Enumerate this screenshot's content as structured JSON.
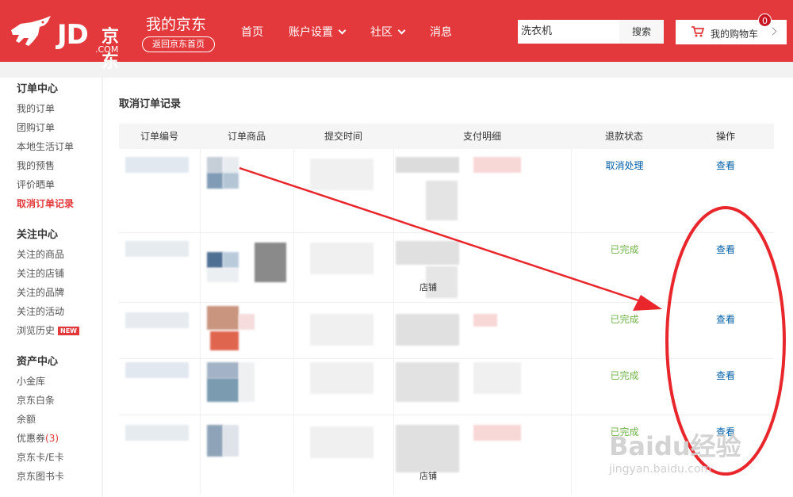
{
  "header": {
    "logo_text": "JD",
    "logo_cn": "京东",
    "logo_com": ".COM",
    "site_title": "我的京东",
    "home_return": "返回京东首页",
    "nav": [
      {
        "label": "首页",
        "has_dropdown": false
      },
      {
        "label": "账户设置",
        "has_dropdown": true
      },
      {
        "label": "社区",
        "has_dropdown": true
      },
      {
        "label": "消息",
        "has_dropdown": false
      }
    ],
    "search": {
      "value": "洗衣机",
      "button": "搜索"
    },
    "cart": {
      "label": "我的购物车",
      "count": "0",
      "icon": "cart-icon"
    },
    "brand_color": "#e4393c"
  },
  "sidebar": {
    "groups": [
      {
        "title": "订单中心",
        "items": [
          {
            "label": "我的订单"
          },
          {
            "label": "团购订单"
          },
          {
            "label": "本地生活订单"
          },
          {
            "label": "我的预售"
          },
          {
            "label": "评价晒单"
          },
          {
            "label": "取消订单记录",
            "active": true
          }
        ]
      },
      {
        "title": "关注中心",
        "items": [
          {
            "label": "关注的商品"
          },
          {
            "label": "关注的店铺"
          },
          {
            "label": "关注的品牌"
          },
          {
            "label": "关注的活动"
          },
          {
            "label": "浏览历史",
            "tag": "NEW"
          }
        ]
      },
      {
        "title": "资产中心",
        "items": [
          {
            "label": "小金库"
          },
          {
            "label": "京东白条"
          },
          {
            "label": "余额"
          },
          {
            "label": "优惠券",
            "count": "(3)"
          },
          {
            "label": "京东卡/E卡"
          },
          {
            "label": "京东图书卡"
          }
        ]
      }
    ]
  },
  "main": {
    "title": "取消订单记录",
    "columns": [
      "订单编号",
      "订单商品",
      "提交时间",
      "支付明细",
      "退款状态",
      "操作"
    ],
    "rows": [
      {
        "status": "取消处理",
        "status_type": "cancel",
        "action": "查看",
        "note": ""
      },
      {
        "status": "已完成",
        "status_type": "done",
        "action": "查看",
        "note": "店铺"
      },
      {
        "status": "已完成",
        "status_type": "done",
        "action": "查看",
        "note": ""
      },
      {
        "status": "已完成",
        "status_type": "done",
        "action": "查看",
        "note": ""
      },
      {
        "status": "已完成",
        "status_type": "done",
        "action": "查看",
        "note": "店铺"
      }
    ]
  },
  "watermark": {
    "text": "Baidu经验",
    "url": "jingyan.baidu.com"
  },
  "annotation_color": "#e8262c"
}
